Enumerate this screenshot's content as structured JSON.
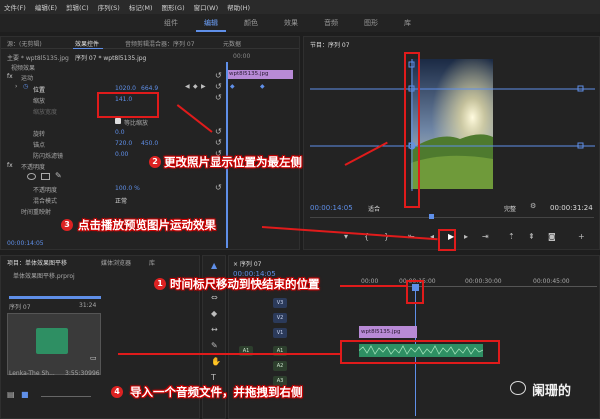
{
  "menubar": {
    "items": [
      "文件(F)",
      "编辑(E)",
      "剪辑(C)",
      "序列(S)",
      "标记(M)",
      "图形(G)",
      "窗口(W)",
      "帮助(H)"
    ]
  },
  "workspace_tabs": [
    "组件",
    "编辑",
    "颜色",
    "效果",
    "音频",
    "图形",
    "库"
  ],
  "effect_controls": {
    "tabs": [
      "源：(无剪辑)",
      "效果控件",
      "音频剪辑混合器：序列 07",
      "元数据"
    ],
    "clip_label": "主要 * wpt8l5135.jpg",
    "sequence_label": "序列 07 * wpt8l5135.jpg",
    "section_video": "视频效果",
    "mini_clip": "wpt8l5135.jpg",
    "mini_time": "00:00",
    "fx_motion": "运动",
    "position_label": "位置",
    "position_x": "1020.0",
    "position_y": "664.9",
    "scale_label": "缩放",
    "scale_value": "141.0",
    "scale_width_label": "缩放宽度",
    "uniform_scale": "等比缩放",
    "rotation_label": "旋转",
    "rotation_value": "0.0",
    "anchor_label": "锚点",
    "anchor_x": "720.0",
    "anchor_y": "450.0",
    "antiflicker_label": "防闪烁滤镜",
    "antiflicker_value": "0.00",
    "opacity_section": "不透明度",
    "opacity_label": "不透明度",
    "opacity_value": "100.0 %",
    "blend_label": "混合模式",
    "blend_value": "正常",
    "time_remap": "时间重映射",
    "timecode": "00:00:14:05"
  },
  "program_monitor": {
    "title": "节目：序列 07",
    "timecode_left": "00:00:14:05",
    "fit_label": "适合",
    "quality_label": "完整",
    "timecode_right": "00:00:31:24"
  },
  "project_panel": {
    "tabs": [
      "项目：单体效果图平移",
      "媒体浏览器",
      "库"
    ],
    "file_label": "单体效果图平移.prproj",
    "seq_name": "序列 07",
    "seq_duration": "31:24",
    "audio_name": "Lenka-The Sh...",
    "audio_duration": "3:55:30996"
  },
  "timeline": {
    "tab_label": "× 序列 07",
    "timecode": "00:00:14:05",
    "ruler": [
      "00:00",
      "00:00:15:00",
      "00:00:30:00",
      "00:00:45:00"
    ],
    "tracks_video": [
      "V3",
      "V2",
      "V1"
    ],
    "tracks_audio": [
      "A1",
      "A2",
      "A3"
    ],
    "source_a1": "A1",
    "clip_label": "wpt8l5135.jpg",
    "audio_clip_label": ""
  },
  "annotations": {
    "a1": "时间标尺移动到快结束的位置",
    "a2": "更改照片显示位置为最左侧",
    "a3": "点击播放预览图片运动效果",
    "a4": "导入一个音频文件，并拖拽到右侧",
    "n1": "1",
    "n2": "2",
    "n3": "3",
    "n4": "4"
  },
  "watermark": {
    "text": "阑珊的"
  },
  "colors": {
    "accent": "#5f8fe8",
    "annotation_red": "#e01b1b",
    "clip_purple": "#b88ad6",
    "audio_green": "#2e8f63"
  }
}
